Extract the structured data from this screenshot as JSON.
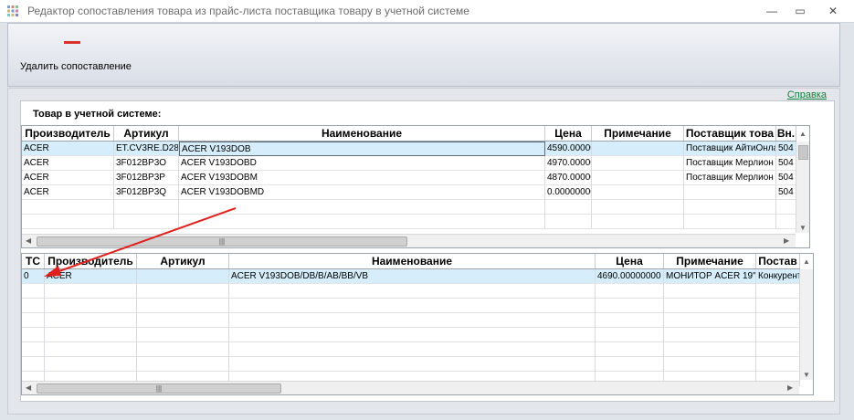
{
  "window": {
    "title": "Редактор сопоставления товара из прайс-листа поставщика товару в учетной системе",
    "app_icon": "grid-app-icon",
    "controls": {
      "minimize": "—",
      "restore": "▭",
      "close": "✕"
    }
  },
  "toolbar": {
    "delete_label": "Удалить сопоставление",
    "delete_icon": "minus-icon",
    "icon_color": "#d9302b"
  },
  "help_link": "Справка",
  "accounting": {
    "title": "Товар в учетной системе:",
    "columns": [
      "Производитель",
      "Артикул",
      "Наименование",
      "Цена",
      "Примечание",
      "Поставщик това",
      "Вн."
    ],
    "rows": [
      [
        "ACER",
        "ET.CV3RE.D28",
        "ACER V193DOB",
        "4590.00000",
        "",
        "Поставщик АйтиОнлайн",
        "504"
      ],
      [
        "ACER",
        "3F012BP3O",
        "ACER V193DOBD",
        "4970.00000",
        "",
        "Поставщик Мерлион",
        "504"
      ],
      [
        "ACER",
        "3F012BP3P",
        "ACER V193DOBM",
        "4870.00000",
        "",
        "Поставщик Мерлион",
        "504"
      ],
      [
        "ACER",
        "3F012BP3Q",
        "ACER V193DOBMD",
        "0.00000000",
        "",
        "",
        "504"
      ]
    ],
    "scroll_grip": "|||"
  },
  "pricelist": {
    "columns": [
      "ТС",
      "Производитель",
      "Артикул",
      "Наименование",
      "Цена",
      "Примечание",
      "Постав"
    ],
    "rows": [
      [
        "0",
        "ACER",
        "",
        "ACER V193DOB/DB/B/AB/BB/VB",
        "4690.00000000",
        "МОНИТОР ACER 19\"",
        "Конкурент"
      ]
    ],
    "scroll_grip": "|||"
  },
  "annotation": {
    "type": "red-arrow",
    "color": "#e0201c"
  }
}
